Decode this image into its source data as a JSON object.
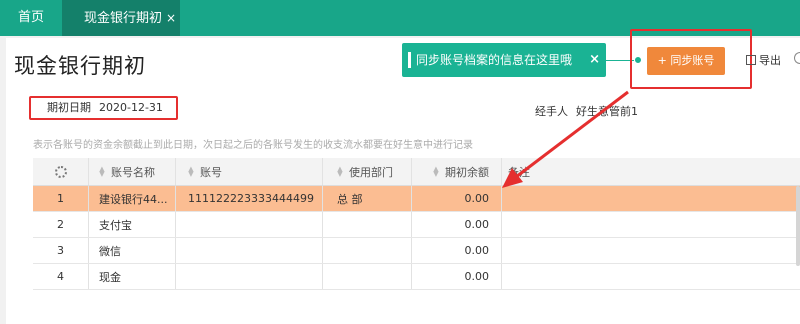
{
  "tabs": {
    "home": "首页",
    "active": "现金银行期初",
    "close": "×"
  },
  "page": {
    "title": "现金银行期初"
  },
  "tip": {
    "text": "同步账号档案的信息在这里哦",
    "close": "×"
  },
  "toolbar": {
    "sync": "+ 同步账号",
    "export": "导出"
  },
  "form": {
    "date_label": "期初日期",
    "date_value": "2020-12-31",
    "handler_label": "经手人",
    "handler_value": "好生意管前1"
  },
  "description": "表示各账号的资金余额截止到此日期，次日起之后的各账号发生的收支流水都要在好生意中进行记录",
  "table": {
    "columns": {
      "name": "账号名称",
      "account": "账号",
      "dept": "使用部门",
      "balance": "期初余额",
      "note": "备注"
    },
    "rows": [
      {
        "idx": "1",
        "name": "建设银行44...",
        "account": "111122223333444499",
        "dept": "总 部",
        "balance": "0.00",
        "note": ""
      },
      {
        "idx": "2",
        "name": "支付宝",
        "account": "",
        "dept": "",
        "balance": "0.00",
        "note": ""
      },
      {
        "idx": "3",
        "name": "微信",
        "account": "",
        "dept": "",
        "balance": "0.00",
        "note": ""
      },
      {
        "idx": "4",
        "name": "现金",
        "account": "",
        "dept": "",
        "balance": "0.00",
        "note": ""
      }
    ]
  },
  "colors": {
    "primary": "#18a689",
    "tip": "#1ab394",
    "sync_button": "#f0883b",
    "selected_row": "#fbbd92",
    "highlight": "#e52f2f"
  }
}
